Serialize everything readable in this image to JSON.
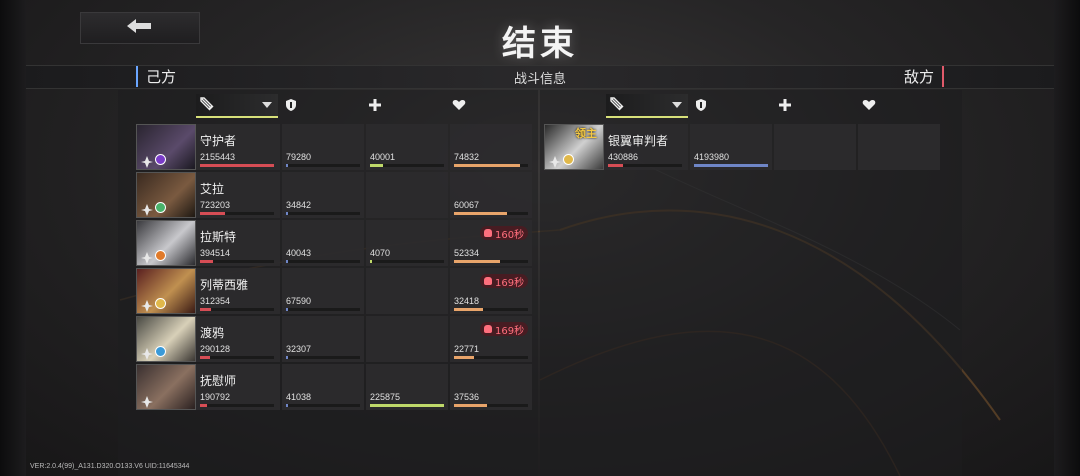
{
  "title": "结束",
  "header": {
    "left_label": "己方",
    "center_label": "战斗信息",
    "right_label": "敌方"
  },
  "version": "VER:2.0.4(99)_A131.D320.O133.V6   UID:11645344",
  "icons": {
    "back": "arrow-left-icon",
    "damage": "sword-icon",
    "tank": "shield-icon",
    "heal": "plus-icon",
    "support": "heart-icon"
  },
  "colors": {
    "damage_bar": "#d64d55",
    "tank_bar": "#6f86c7",
    "heal_bar": "#bfd96a",
    "support_bar": "#e8a46a",
    "selected_col": "#d7e07a",
    "death_text": "#ff6f7d"
  },
  "allies": [
    {
      "name": "守护者",
      "damage": "2155443",
      "damage_frac": 1.0,
      "tank": "79280",
      "tank_frac": 0.02,
      "heal": "40001",
      "heal_frac": 0.18,
      "support": "74832",
      "support_frac": 0.89,
      "death": ""
    },
    {
      "name": "艾拉",
      "damage": "723203",
      "damage_frac": 0.34,
      "tank": "34842",
      "tank_frac": 0.01,
      "heal": "",
      "heal_frac": 0,
      "support": "60067",
      "support_frac": 0.72,
      "death": ""
    },
    {
      "name": "拉斯特",
      "damage": "394514",
      "damage_frac": 0.18,
      "tank": "40043",
      "tank_frac": 0.01,
      "heal": "4070",
      "heal_frac": 0.02,
      "support": "52334",
      "support_frac": 0.62,
      "death": "160秒"
    },
    {
      "name": "列蒂西雅",
      "damage": "312354",
      "damage_frac": 0.15,
      "tank": "67590",
      "tank_frac": 0.02,
      "heal": "",
      "heal_frac": 0,
      "support": "32418",
      "support_frac": 0.39,
      "death": "169秒"
    },
    {
      "name": "渡鸦",
      "damage": "290128",
      "damage_frac": 0.13,
      "tank": "32307",
      "tank_frac": 0.01,
      "heal": "",
      "heal_frac": 0,
      "support": "22771",
      "support_frac": 0.27,
      "death": "169秒"
    },
    {
      "name": "抚慰师",
      "damage": "190792",
      "damage_frac": 0.09,
      "tank": "41038",
      "tank_frac": 0.01,
      "heal": "225875",
      "heal_frac": 1.0,
      "support": "37536",
      "support_frac": 0.45,
      "death": ""
    }
  ],
  "enemies": [
    {
      "name": "银翼审判者",
      "boss_tag": "领主",
      "damage": "430886",
      "damage_frac": 0.2,
      "tank": "4193980",
      "tank_frac": 1.0
    }
  ]
}
